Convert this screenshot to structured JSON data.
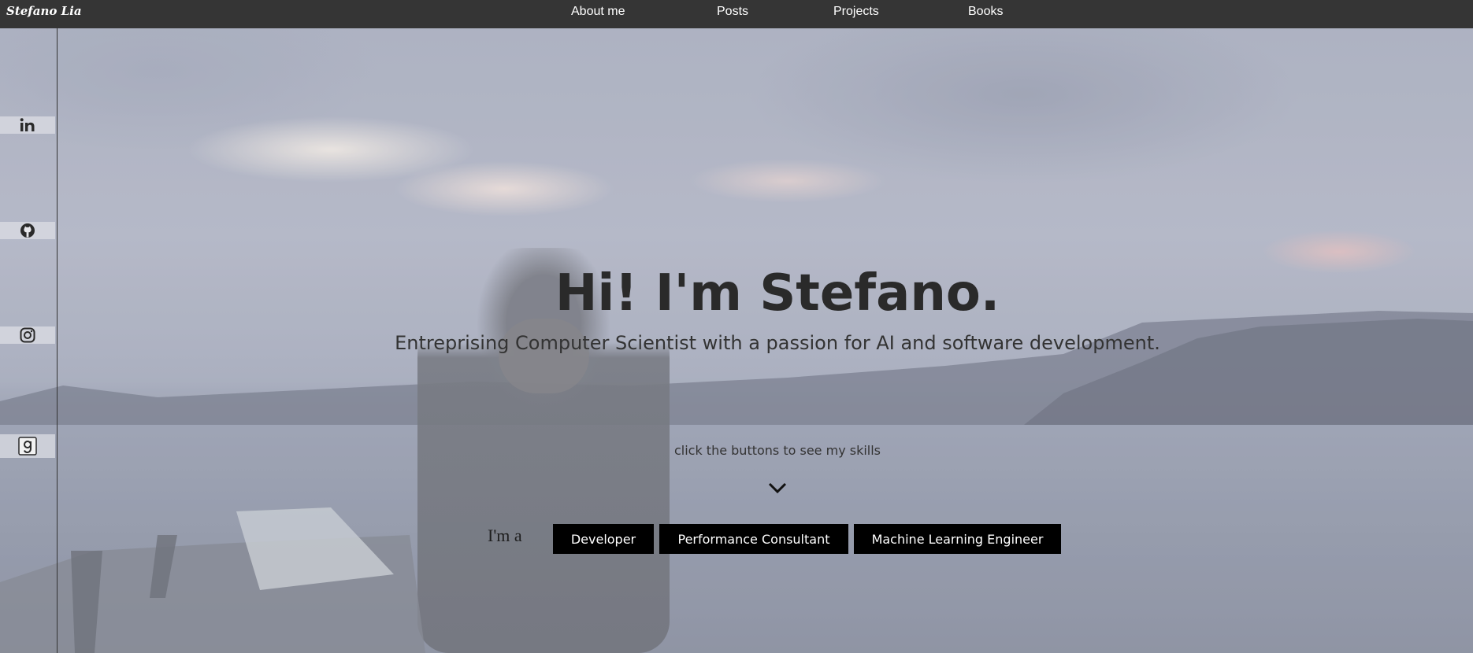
{
  "header": {
    "brand": "Stefano Lia",
    "nav": [
      {
        "label": "About me"
      },
      {
        "label": "Posts"
      },
      {
        "label": "Projects"
      },
      {
        "label": "Books"
      }
    ]
  },
  "sidebar": {
    "socials": [
      {
        "icon": "linkedin-icon"
      },
      {
        "icon": "github-icon"
      },
      {
        "icon": "instagram-icon"
      },
      {
        "icon": "goodreads-icon"
      }
    ]
  },
  "hero": {
    "title": "Hi! I'm Stefano.",
    "subtitle": "Entreprising Computer Scientist with a passion for AI and software development.",
    "hint": "click the buttons to see my skills",
    "prefix": "I'm a",
    "skills": [
      {
        "label": "Developer"
      },
      {
        "label": "Performance Consultant"
      },
      {
        "label": "Machine Learning Engineer"
      }
    ]
  },
  "colors": {
    "topbar": "#353535",
    "button": "#000000",
    "title": "#2a2a2a"
  }
}
